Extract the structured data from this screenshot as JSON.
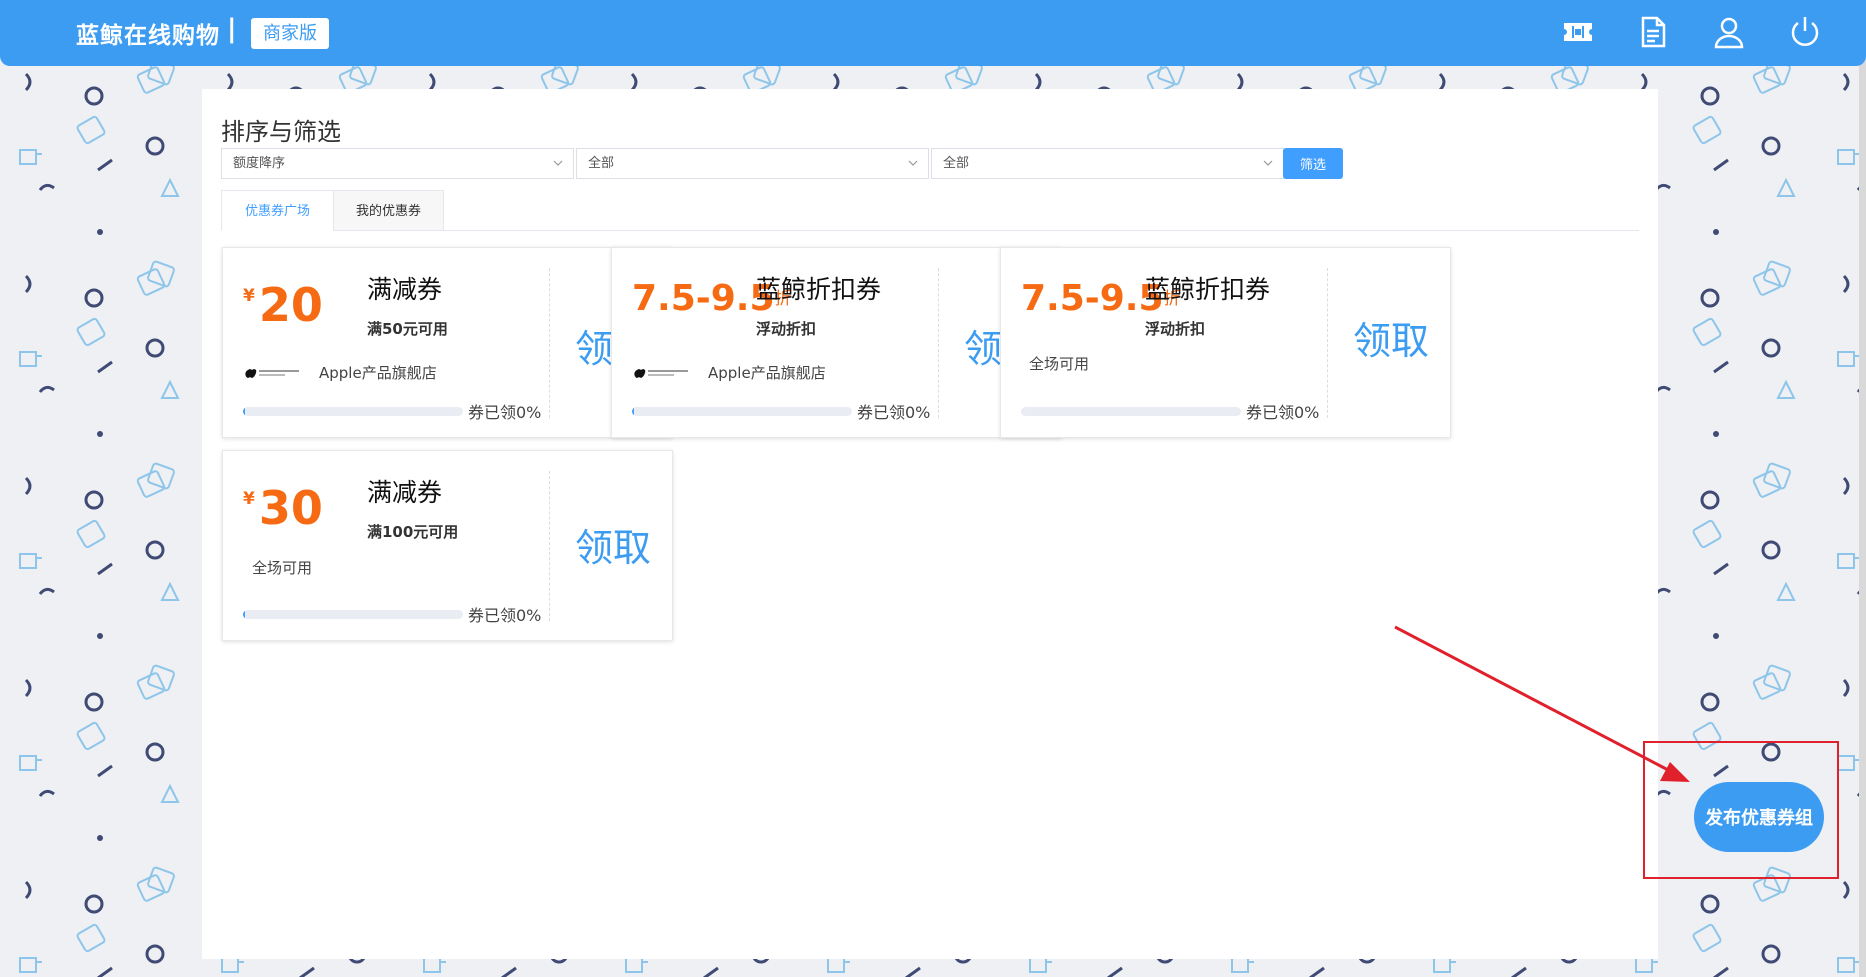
{
  "header": {
    "brand": "蓝鲸在线购物",
    "separator": "|",
    "edition": "商家版",
    "icons": [
      "ticket-icon",
      "document-icon",
      "user-icon",
      "power-icon"
    ]
  },
  "panel": {
    "title": "排序与筛选",
    "sort_select": "额度降序",
    "filter_select_1": "全部",
    "filter_select_2": "全部",
    "filter_button": "筛选",
    "tabs": [
      {
        "label": "优惠券广场",
        "active": true
      },
      {
        "label": "我的优惠券",
        "active": false
      }
    ]
  },
  "coupons": [
    {
      "kind": "amount",
      "currency": "¥",
      "value": "20",
      "title": "满减券",
      "condition": "满50元可用",
      "store": "Apple产品旗舰店",
      "claim": "领取",
      "progress_text": "券已领0%",
      "progress": 0
    },
    {
      "kind": "discount",
      "value": "7.5-9.5",
      "unit": "折",
      "title": "蓝鲸折扣券",
      "condition": "浮动折扣",
      "store": "Apple产品旗舰店",
      "claim": "领取",
      "progress_text": "券已领0%",
      "progress": 0
    },
    {
      "kind": "discount",
      "value": "7.5-9.5",
      "unit": "折",
      "title": "蓝鲸折扣券",
      "condition": "浮动折扣",
      "scope": "全场可用",
      "claim": "领取",
      "progress_text": "券已领0%",
      "progress": 0
    },
    {
      "kind": "amount",
      "currency": "¥",
      "value": "30",
      "title": "满减券",
      "condition": "满100元可用",
      "scope": "全场可用",
      "claim": "领取",
      "progress_text": "券已领0%",
      "progress": 0
    }
  ],
  "publish_button": "发布优惠券组",
  "colors": {
    "header": "#3c9cf2",
    "accent": "#409eff",
    "amount": "#f56a12",
    "annotation": "#e0202a"
  }
}
